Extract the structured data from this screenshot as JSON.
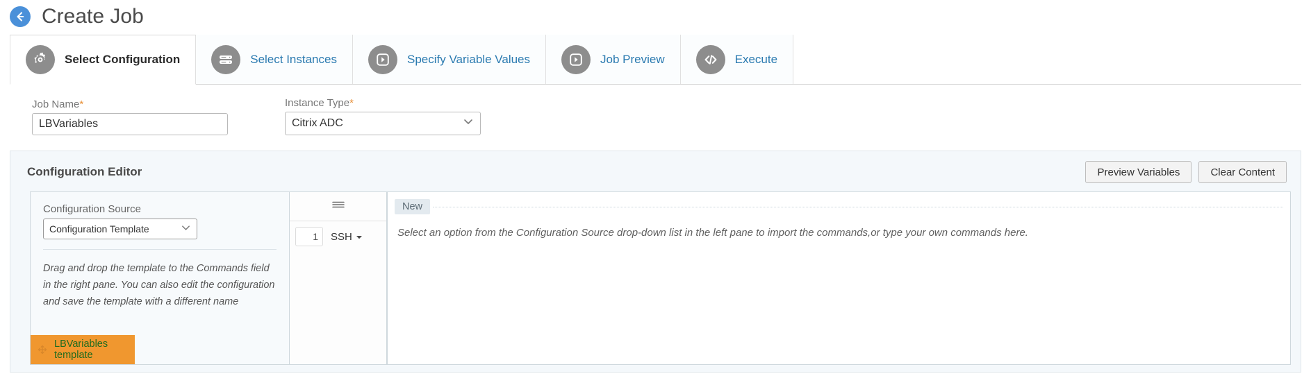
{
  "header": {
    "back_icon": "back-arrow-icon",
    "title": "Create Job"
  },
  "tabs": [
    {
      "label": "Select Configuration",
      "icon": "gear-icon",
      "active": true
    },
    {
      "label": "Select Instances",
      "icon": "server-stack-icon",
      "active": false
    },
    {
      "label": "Specify Variable Values",
      "icon": "play-square-icon",
      "active": false
    },
    {
      "label": "Job Preview",
      "icon": "play-square-icon",
      "active": false
    },
    {
      "label": "Execute",
      "icon": "code-brackets-icon",
      "active": false
    }
  ],
  "form": {
    "job_name": {
      "label": "Job Name",
      "required_mark": "*",
      "value": "LBVariables"
    },
    "instance_type": {
      "label": "Instance Type",
      "required_mark": "*",
      "value": "Citrix ADC",
      "caret_icon": "chevron-down-icon"
    }
  },
  "editor": {
    "title": "Configuration Editor",
    "preview_variables_label": "Preview Variables",
    "clear_content_label": "Clear Content",
    "source": {
      "label": "Configuration Source",
      "value": "Configuration Template",
      "caret_icon": "chevron-down-icon",
      "hint": "Drag and drop the template to the Commands field in the right pane. You can also edit the configuration and save the template with a different name",
      "template_item": {
        "label": "LBVariables template",
        "drag_icon": "move-arrows-icon",
        "background": "#f0972f",
        "text_color": "#1f6b1f"
      }
    },
    "gutter": {
      "menu_icon": "hamburger-menu-icon",
      "line_number": "1",
      "protocol": "SSH",
      "protocol_caret_icon": "caret-down-icon"
    },
    "commands": {
      "tab_label": "New",
      "placeholder": "Select an option from the Configuration Source drop-down list in the left pane to import the commands,or type your own commands here."
    }
  },
  "colors": {
    "accent_blue": "#2a7ab0",
    "back_button": "#4a90d9",
    "panel_bg": "#f4f8fb",
    "icon_grey": "#8d8d8d",
    "required_orange": "#e8913a"
  }
}
